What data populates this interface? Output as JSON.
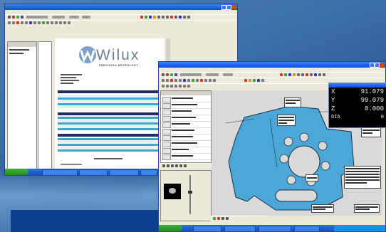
{
  "report_window": {
    "logo": "Wilux",
    "tagline": "PRECISION METROLOGY"
  },
  "dro": {
    "axes": [
      {
        "axis": "X",
        "value": "91.079"
      },
      {
        "axis": "Y",
        "value": "99.079"
      },
      {
        "axis": "Z",
        "value": "0.000"
      },
      {
        "axis": "DIA",
        "value": "0"
      }
    ]
  },
  "colors": {
    "desktop": "#3d6fa8",
    "part_fill": "#4ba7d8",
    "canvas_bg": "#d9d9d9",
    "dro_bg": "#000000",
    "taskbar": "#2160d8",
    "title_bar": "#0a4fd4"
  }
}
